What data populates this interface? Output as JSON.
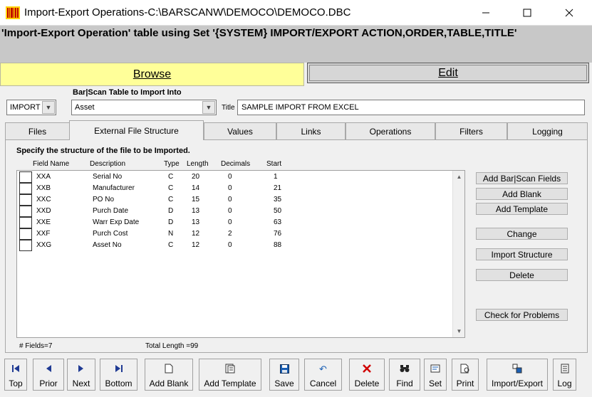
{
  "window": {
    "title": "Import-Export Operations-C:\\BARSCANW\\DEMOCO\\DEMOCO.DBC",
    "minimize_icon": "minimize-icon",
    "maximize_icon": "maximize-icon",
    "close_icon": "close-icon"
  },
  "header": {
    "text": "'Import-Export Operation' table using Set '{SYSTEM} IMPORT/EXPORT ACTION,ORDER,TABLE,TITLE'"
  },
  "modes": {
    "browse": "Browse",
    "edit": "Edit",
    "browse_color": "#ffff99"
  },
  "selection": {
    "type_value": "IMPORT",
    "table_label": "Bar|Scan Table to Import Into",
    "table_value": "Asset",
    "title_label": "Title",
    "title_value": "SAMPLE IMPORT FROM EXCEL"
  },
  "tabs": [
    {
      "label": "Files"
    },
    {
      "label": "External File Structure"
    },
    {
      "label": "Values"
    },
    {
      "label": "Links"
    },
    {
      "label": "Operations"
    },
    {
      "label": "Filters"
    },
    {
      "label": "Logging"
    }
  ],
  "active_tab": "External File Structure",
  "structure": {
    "instruction": "Specify the structure of the file to be Imported.",
    "columns": {
      "field_name": "Field Name",
      "description": "Description",
      "type": "Type",
      "length": "Length",
      "decimals": "Decimals",
      "start": "Start"
    },
    "rows": [
      {
        "field": "XXA",
        "desc": "Serial No",
        "type": "C",
        "length": "20",
        "decimals": "0",
        "start": "1"
      },
      {
        "field": "XXB",
        "desc": "Manufacturer",
        "type": "C",
        "length": "14",
        "decimals": "0",
        "start": "21"
      },
      {
        "field": "XXC",
        "desc": "PO No",
        "type": "C",
        "length": "15",
        "decimals": "0",
        "start": "35"
      },
      {
        "field": "XXD",
        "desc": "Purch Date",
        "type": "D",
        "length": "13",
        "decimals": "0",
        "start": "50"
      },
      {
        "field": "XXE",
        "desc": "Warr Exp Date",
        "type": "D",
        "length": "13",
        "decimals": "0",
        "start": "63"
      },
      {
        "field": "XXF",
        "desc": "Purch Cost",
        "type": "N",
        "length": "12",
        "decimals": "2",
        "start": "76"
      },
      {
        "field": "XXG",
        "desc": "Asset No",
        "type": "C",
        "length": "12",
        "decimals": "0",
        "start": "88"
      }
    ],
    "fields_count": "# Fields=7",
    "total_length": "Total Length =99"
  },
  "side_buttons": {
    "add_fields": "Add Bar|Scan Fields",
    "add_blank": "Add Blank",
    "add_template": "Add Template",
    "change": "Change",
    "import_structure": "Import Structure",
    "delete": "Delete",
    "check_problems": "Check for Problems"
  },
  "toolbar": {
    "top": {
      "label": "Top",
      "icon": "first-record-icon"
    },
    "prior": {
      "label": "Prior",
      "icon": "previous-record-icon"
    },
    "next": {
      "label": "Next",
      "icon": "next-record-icon"
    },
    "bottom": {
      "label": "Bottom",
      "icon": "last-record-icon"
    },
    "add_blank": {
      "label": "Add Blank",
      "icon": "new-document-icon"
    },
    "add_template": {
      "label": "Add Template",
      "icon": "template-icon"
    },
    "save": {
      "label": "Save",
      "icon": "floppy-disk-icon"
    },
    "cancel": {
      "label": "Cancel",
      "icon": "undo-icon"
    },
    "delete": {
      "label": "Delete",
      "icon": "red-x-icon"
    },
    "find": {
      "label": "Find",
      "icon": "binoculars-icon"
    },
    "set": {
      "label": "Set",
      "icon": "set-order-icon"
    },
    "print": {
      "label": "Print",
      "icon": "print-preview-icon"
    },
    "import_export": {
      "label": "Import/Export",
      "icon": "import-export-icon"
    },
    "log": {
      "label": "Log",
      "icon": "log-icon"
    }
  },
  "accent_colors": {
    "nav_arrow": "#1f3a93",
    "delete_x": "#d00000",
    "save_disk": "#1a5fb4"
  }
}
